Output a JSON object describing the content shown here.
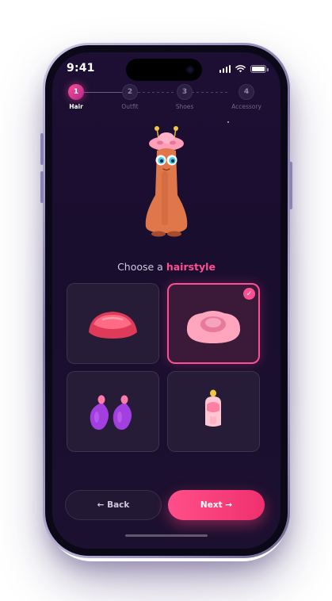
{
  "status_bar": {
    "time": "9:41",
    "icons": [
      "cellular-signal-icon",
      "wifi-icon",
      "battery-icon"
    ]
  },
  "stepper": {
    "steps": [
      {
        "number": "1",
        "label": "Hair",
        "state": "active"
      },
      {
        "number": "2",
        "label": "Outfit",
        "state": "upcoming"
      },
      {
        "number": "3",
        "label": "Shoes",
        "state": "upcoming"
      },
      {
        "number": "4",
        "label": "Accessory",
        "state": "upcoming"
      }
    ]
  },
  "preview": {
    "icon": "character-preview"
  },
  "prompt": {
    "prefix": "Choose a ",
    "highlight": "hairstyle"
  },
  "options": [
    {
      "icon": "red-cap-hair-icon",
      "selected": false
    },
    {
      "icon": "pink-bun-hair-icon",
      "selected": true
    },
    {
      "icon": "purple-pigtails-hair-icon",
      "selected": false
    },
    {
      "icon": "mohawk-hair-icon",
      "selected": false
    }
  ],
  "selected_check": "✓",
  "buttons": {
    "back": "← Back",
    "next": "Next →"
  },
  "colors": {
    "background": "#1a0e2e",
    "accent": "#ff4f93",
    "card": "#271c38"
  }
}
